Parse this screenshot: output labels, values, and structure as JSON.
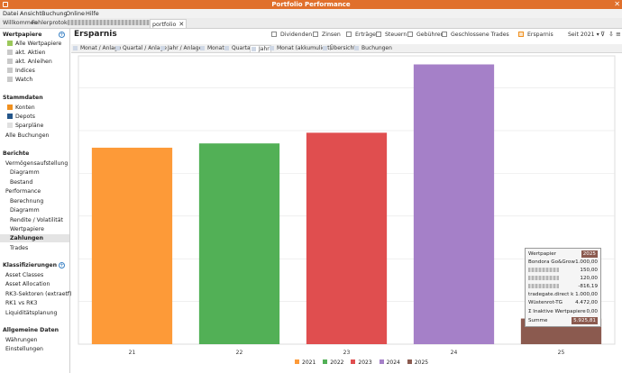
{
  "window": {
    "title": "Portfolio Performance",
    "close_glyph": "✕"
  },
  "menu": [
    "Datei",
    "Ansicht",
    "Buchung",
    "Online",
    "Hilfe"
  ],
  "tabs": [
    {
      "label": "Willkommen"
    },
    {
      "label": "Fehlerprotokoll"
    },
    {
      "label": "portfolio",
      "close": "✕"
    }
  ],
  "sidebar": {
    "sections": [
      {
        "title": "Wertpapiere",
        "items": [
          "Alle Wertpapiere",
          "akt. Aktien",
          "akt. Anleihen",
          "Indices",
          "Watch"
        ]
      },
      {
        "title": "Stammdaten",
        "items": [
          "Konten",
          "Depots",
          "Sparpläne",
          "Alle Buchungen"
        ]
      },
      {
        "title": "Berichte",
        "items": [
          "Vermögensaufstellung",
          "Diagramm",
          "Bestand",
          "Performance",
          "Berechnung",
          "Diagramm",
          "Rendite / Volatilität",
          "Wertpapiere",
          "Zahlungen",
          "Trades"
        ]
      },
      {
        "title": "Klassifizierungen",
        "items": [
          "Asset Classes",
          "Asset Allocation",
          "RK3-Sektoren (extraetf)",
          "RK1 vs RK3",
          "Liquiditätsplanung"
        ]
      },
      {
        "title": "Allgemeine Daten",
        "items": [
          "Währungen",
          "Einstellungen"
        ]
      }
    ],
    "selected": "Zahlungen",
    "plus_glyph": "+"
  },
  "header": {
    "title": "Ersparnis",
    "filters": [
      "Dividenden",
      "Zinsen",
      "Erträge",
      "Steuern",
      "Gebühren",
      "Geschlossene Trades",
      "Ersparnis"
    ],
    "period": "Seit 2021",
    "period_chevron": "▾"
  },
  "subtabs": [
    "Monat / Anlage",
    "Quartal / Anlage",
    "Jahr / Anlage",
    "Monat",
    "Quartal",
    "Jahr",
    "Monat (akkumuliert)",
    "Übersicht",
    "Buchungen"
  ],
  "active_subtab": "Jahr",
  "toolbar_icons": [
    "filter-icon",
    "export-icon",
    "menu-icon"
  ],
  "colors": {
    "title_bar": "#e0702c",
    "2021": "#fd9a38",
    "2022": "#52b056",
    "2023": "#e04e4f",
    "2024": "#a580c8",
    "2025": "#8b5a4f"
  },
  "chart_data": {
    "type": "bar",
    "categories": [
      "21",
      "22",
      "23",
      "24",
      "25"
    ],
    "series": [
      {
        "name": "2021",
        "values": [
          9200,
          null,
          null,
          null,
          null
        ]
      },
      {
        "name": "2022",
        "values": [
          null,
          9400,
          null,
          null,
          null
        ]
      },
      {
        "name": "2023",
        "values": [
          null,
          null,
          9900,
          null,
          null
        ]
      },
      {
        "name": "2024",
        "values": [
          null,
          null,
          null,
          13100,
          null
        ]
      },
      {
        "name": "2025",
        "values": [
          null,
          null,
          null,
          null,
          1200
        ]
      }
    ],
    "ylim": [
      0,
      13500
    ],
    "grid": true,
    "legend": "bottom"
  },
  "tooltip": {
    "header_label": "Wertpapier",
    "header_year": "2025",
    "rows": [
      {
        "label": "Bondora Go&Grow",
        "value": "1.000,00",
        "blurred": false
      },
      {
        "label": "",
        "value": "150,00",
        "blurred": true
      },
      {
        "label": "",
        "value": "120,00",
        "blurred": true
      },
      {
        "label": "",
        "value": "-816,19",
        "blurred": true
      },
      {
        "label": "tradegate.direct k",
        "value": "1.000,00",
        "blurred": false
      },
      {
        "label": "Wüstenrot-TG",
        "value": "4.472,00",
        "blurred": false
      },
      {
        "label": "Σ Inaktive Wertpapiere",
        "value": "0,00",
        "blurred": false
      }
    ],
    "sum_label": "Summe",
    "sum_value": "5.925,81"
  }
}
